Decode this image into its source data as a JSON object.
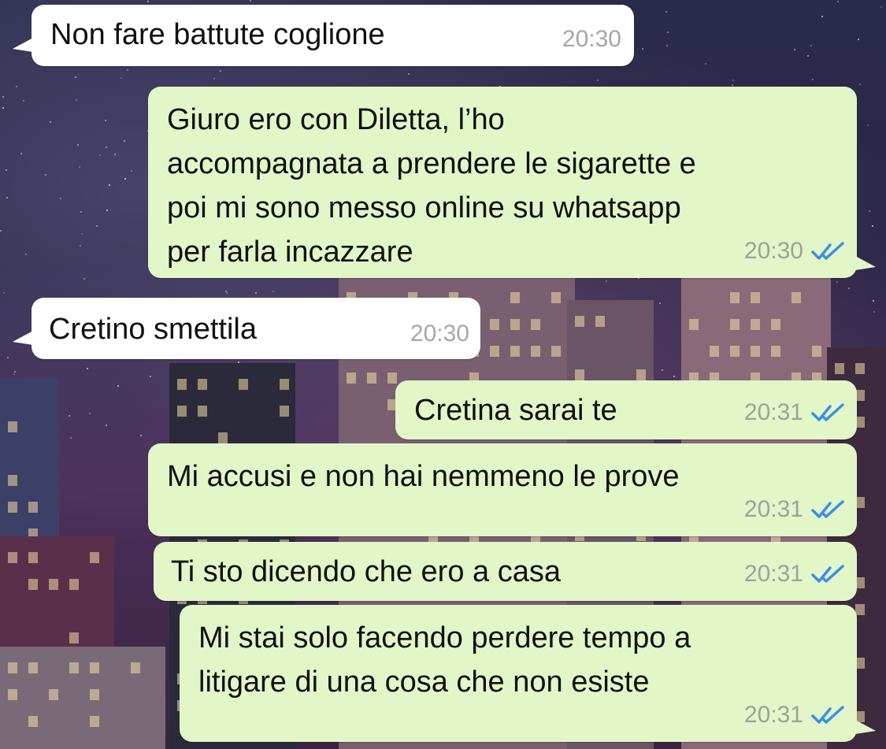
{
  "messages": [
    {
      "id": "m1",
      "direction": "incoming",
      "text": "Non fare battute coglione",
      "time": "20:30",
      "status": ""
    },
    {
      "id": "m2",
      "direction": "outgoing",
      "text": "Giuro ero con Diletta, l’ho\naccompagnata a prendere le sigarette e\npoi mi sono messo online su whatsapp\nper farla incazzare",
      "time": "20:30",
      "status": "read"
    },
    {
      "id": "m3",
      "direction": "incoming",
      "text": "Cretino smettila",
      "time": "20:30",
      "status": ""
    },
    {
      "id": "m4",
      "direction": "outgoing",
      "text": "Cretina sarai te",
      "time": "20:31",
      "status": "read"
    },
    {
      "id": "m5",
      "direction": "outgoing",
      "text": "Mi accusi e non hai nemmeno le prove",
      "time": "20:31",
      "status": "read"
    },
    {
      "id": "m6",
      "direction": "outgoing",
      "text": "Ti sto dicendo che ero a casa",
      "time": "20:31",
      "status": "read"
    },
    {
      "id": "m7",
      "direction": "outgoing",
      "text": "Mi stai solo facendo perdere tempo a\nlitigare di una cosa che non esiste",
      "time": "20:31",
      "status": "read"
    }
  ],
  "colors": {
    "incoming_bubble": "#ffffff",
    "outgoing_bubble": "#e2f6c8",
    "read_ticks": "#3b8fe6",
    "timestamp": "#9aa49a"
  },
  "icons": {
    "read_receipt": "double-check-icon"
  }
}
